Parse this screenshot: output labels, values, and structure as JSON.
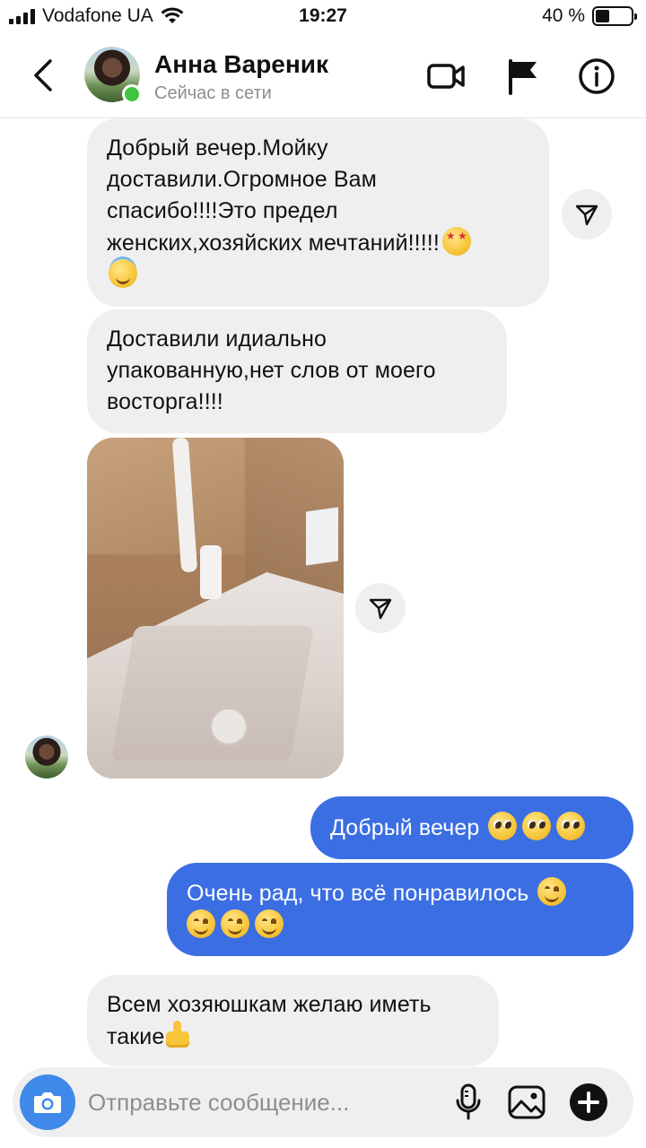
{
  "status_bar": {
    "carrier": "Vodafone UA",
    "time": "19:27",
    "battery_percent": "40 %",
    "battery_level": 0.4
  },
  "header": {
    "contact_name": "Анна Вареник",
    "contact_status": "Сейчас в сети",
    "icons": [
      "back-chevron-icon",
      "video-call-icon",
      "flag-icon",
      "info-icon"
    ]
  },
  "messages": [
    {
      "side": "incoming",
      "text_lines": [
        "Добрый вечер.Мойку",
        "доставили.Огромное Вам",
        "спасибо!!!!Это предел",
        "женских,хозяйских мечтаний!!!!!"
      ],
      "emojis": [
        "star-struck-emoji",
        "smiling-face-with-halo-emoji"
      ]
    },
    {
      "side": "incoming",
      "text_lines": [
        "Доставили идиально",
        "упакованную,нет слов от моего",
        "восторга!!!!"
      ]
    },
    {
      "side": "incoming",
      "type": "photo",
      "photo_subject": "kitchen-sink-in-box"
    },
    {
      "side": "outgoing",
      "text": "Добрый вечер",
      "emojis": [
        "pleading-face-emoji",
        "pleading-face-emoji",
        "pleading-face-emoji"
      ]
    },
    {
      "side": "outgoing",
      "text": "Очень рад, что всё понравилось",
      "emojis": [
        "smiling-face-emoji",
        "smiling-face-emoji",
        "smiling-face-emoji",
        "smiling-face-emoji"
      ]
    },
    {
      "side": "incoming",
      "text_lines": [
        "Всем хозяюшкам желаю иметь",
        "такие"
      ],
      "emojis": [
        "thumbs-up-emoji"
      ]
    }
  ],
  "composer": {
    "placeholder": "Отправьте сообщение...",
    "icons": [
      "camera-icon",
      "microphone-icon",
      "gallery-icon",
      "plus-icon"
    ]
  },
  "colors": {
    "outgoing_bubble": "#3b6ee2",
    "incoming_bubble": "#efefef",
    "online": "#3ec43e",
    "camera_button": "#3f8ae8"
  }
}
